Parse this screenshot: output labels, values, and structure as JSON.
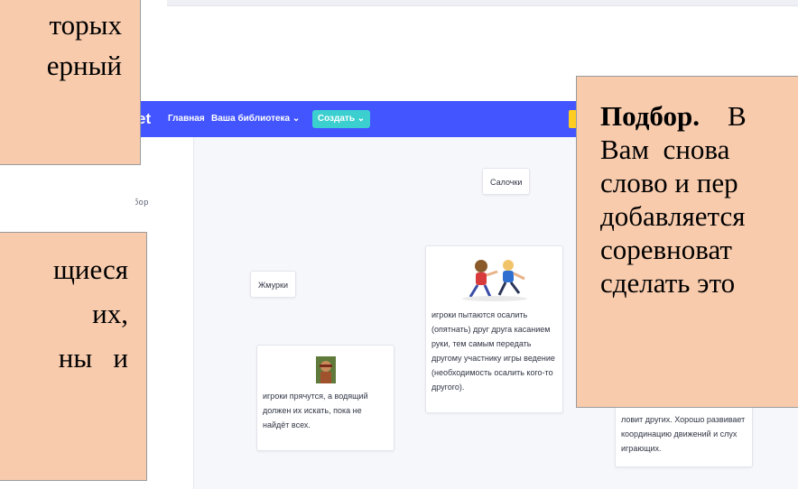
{
  "nav": {
    "logo_fragment": "et",
    "home": "Главная",
    "library": "Ваша библиотека",
    "create": "Создать"
  },
  "mode_label": "Подбор",
  "cards": {
    "salochki": "Салочки",
    "zhmurki": "Жмурки",
    "salochki_desc": "игроки пытаются осалить (опятнать) друг друга касанием руки, тем самым передать другому участнику игры ведение (необходимость осалить кого-то другого).",
    "zhmurki_desc": "игроки прячутся, а водящий должен их искать, пока не найдёт всех.",
    "partial_desc": "ловит других. Хорошо развивает координацию движений и слух играющих."
  },
  "overlays": {
    "top_lines": [
      "торых",
      "ерный"
    ],
    "left_lines": [
      "щиеся",
      "их,",
      "ны   и"
    ],
    "right_bold": "Подбор.",
    "right_first_rest": "В",
    "right_lines": [
      "Вам  снова",
      "слово и пер",
      "добавляется",
      "соревноват",
      "сделать это"
    ]
  },
  "colors": {
    "nav_bg": "#4255ff",
    "create_btn": "#3ccfcf",
    "overlay_bg": "#f8cbad"
  }
}
